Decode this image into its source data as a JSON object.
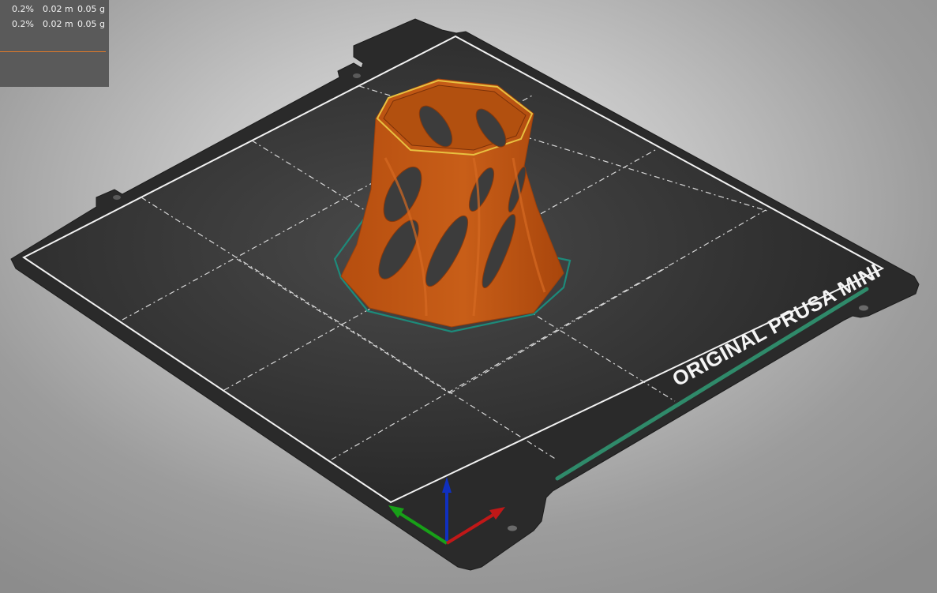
{
  "legend": {
    "rows": [
      {
        "percent": "0.2%",
        "length": "0.02 m",
        "weight": "0.05 g"
      },
      {
        "percent": "0.2%",
        "length": "0.02 m",
        "weight": "0.05 g"
      }
    ],
    "separator_color": "#e07a2a"
  },
  "bed": {
    "label": "ORIGINAL PRUSA MINI",
    "plate_color": "#2c2c2c",
    "surface_color": "#3a3a3a",
    "accent_color": "#2f8a6a"
  },
  "model": {
    "color": "#c45a14",
    "skirt_color": "#1d8a7a"
  },
  "axes": {
    "x_color": "#c01818",
    "y_color": "#18a018",
    "z_color": "#1030c0"
  },
  "icons": {
    "print_bed": "bed-plate",
    "model": "twisted-vase-model",
    "axes": "xyz-axes-gizmo"
  }
}
